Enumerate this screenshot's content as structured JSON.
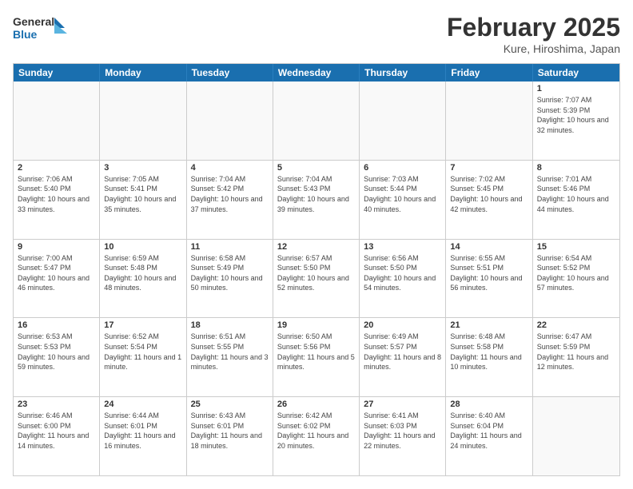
{
  "header": {
    "logo_general": "General",
    "logo_blue": "Blue",
    "month_title": "February 2025",
    "location": "Kure, Hiroshima, Japan"
  },
  "days_of_week": [
    "Sunday",
    "Monday",
    "Tuesday",
    "Wednesday",
    "Thursday",
    "Friday",
    "Saturday"
  ],
  "weeks": [
    [
      {
        "day": "",
        "empty": true
      },
      {
        "day": "",
        "empty": true
      },
      {
        "day": "",
        "empty": true
      },
      {
        "day": "",
        "empty": true
      },
      {
        "day": "",
        "empty": true
      },
      {
        "day": "",
        "empty": true
      },
      {
        "day": "1",
        "sunrise": "7:07 AM",
        "sunset": "5:39 PM",
        "daylight": "10 hours and 32 minutes."
      }
    ],
    [
      {
        "day": "2",
        "sunrise": "7:06 AM",
        "sunset": "5:40 PM",
        "daylight": "10 hours and 33 minutes."
      },
      {
        "day": "3",
        "sunrise": "7:05 AM",
        "sunset": "5:41 PM",
        "daylight": "10 hours and 35 minutes."
      },
      {
        "day": "4",
        "sunrise": "7:04 AM",
        "sunset": "5:42 PM",
        "daylight": "10 hours and 37 minutes."
      },
      {
        "day": "5",
        "sunrise": "7:04 AM",
        "sunset": "5:43 PM",
        "daylight": "10 hours and 39 minutes."
      },
      {
        "day": "6",
        "sunrise": "7:03 AM",
        "sunset": "5:44 PM",
        "daylight": "10 hours and 40 minutes."
      },
      {
        "day": "7",
        "sunrise": "7:02 AM",
        "sunset": "5:45 PM",
        "daylight": "10 hours and 42 minutes."
      },
      {
        "day": "8",
        "sunrise": "7:01 AM",
        "sunset": "5:46 PM",
        "daylight": "10 hours and 44 minutes."
      }
    ],
    [
      {
        "day": "9",
        "sunrise": "7:00 AM",
        "sunset": "5:47 PM",
        "daylight": "10 hours and 46 minutes."
      },
      {
        "day": "10",
        "sunrise": "6:59 AM",
        "sunset": "5:48 PM",
        "daylight": "10 hours and 48 minutes."
      },
      {
        "day": "11",
        "sunrise": "6:58 AM",
        "sunset": "5:49 PM",
        "daylight": "10 hours and 50 minutes."
      },
      {
        "day": "12",
        "sunrise": "6:57 AM",
        "sunset": "5:50 PM",
        "daylight": "10 hours and 52 minutes."
      },
      {
        "day": "13",
        "sunrise": "6:56 AM",
        "sunset": "5:50 PM",
        "daylight": "10 hours and 54 minutes."
      },
      {
        "day": "14",
        "sunrise": "6:55 AM",
        "sunset": "5:51 PM",
        "daylight": "10 hours and 56 minutes."
      },
      {
        "day": "15",
        "sunrise": "6:54 AM",
        "sunset": "5:52 PM",
        "daylight": "10 hours and 57 minutes."
      }
    ],
    [
      {
        "day": "16",
        "sunrise": "6:53 AM",
        "sunset": "5:53 PM",
        "daylight": "10 hours and 59 minutes."
      },
      {
        "day": "17",
        "sunrise": "6:52 AM",
        "sunset": "5:54 PM",
        "daylight": "11 hours and 1 minute."
      },
      {
        "day": "18",
        "sunrise": "6:51 AM",
        "sunset": "5:55 PM",
        "daylight": "11 hours and 3 minutes."
      },
      {
        "day": "19",
        "sunrise": "6:50 AM",
        "sunset": "5:56 PM",
        "daylight": "11 hours and 5 minutes."
      },
      {
        "day": "20",
        "sunrise": "6:49 AM",
        "sunset": "5:57 PM",
        "daylight": "11 hours and 8 minutes."
      },
      {
        "day": "21",
        "sunrise": "6:48 AM",
        "sunset": "5:58 PM",
        "daylight": "11 hours and 10 minutes."
      },
      {
        "day": "22",
        "sunrise": "6:47 AM",
        "sunset": "5:59 PM",
        "daylight": "11 hours and 12 minutes."
      }
    ],
    [
      {
        "day": "23",
        "sunrise": "6:46 AM",
        "sunset": "6:00 PM",
        "daylight": "11 hours and 14 minutes."
      },
      {
        "day": "24",
        "sunrise": "6:44 AM",
        "sunset": "6:01 PM",
        "daylight": "11 hours and 16 minutes."
      },
      {
        "day": "25",
        "sunrise": "6:43 AM",
        "sunset": "6:01 PM",
        "daylight": "11 hours and 18 minutes."
      },
      {
        "day": "26",
        "sunrise": "6:42 AM",
        "sunset": "6:02 PM",
        "daylight": "11 hours and 20 minutes."
      },
      {
        "day": "27",
        "sunrise": "6:41 AM",
        "sunset": "6:03 PM",
        "daylight": "11 hours and 22 minutes."
      },
      {
        "day": "28",
        "sunrise": "6:40 AM",
        "sunset": "6:04 PM",
        "daylight": "11 hours and 24 minutes."
      },
      {
        "day": "",
        "empty": true
      }
    ]
  ]
}
